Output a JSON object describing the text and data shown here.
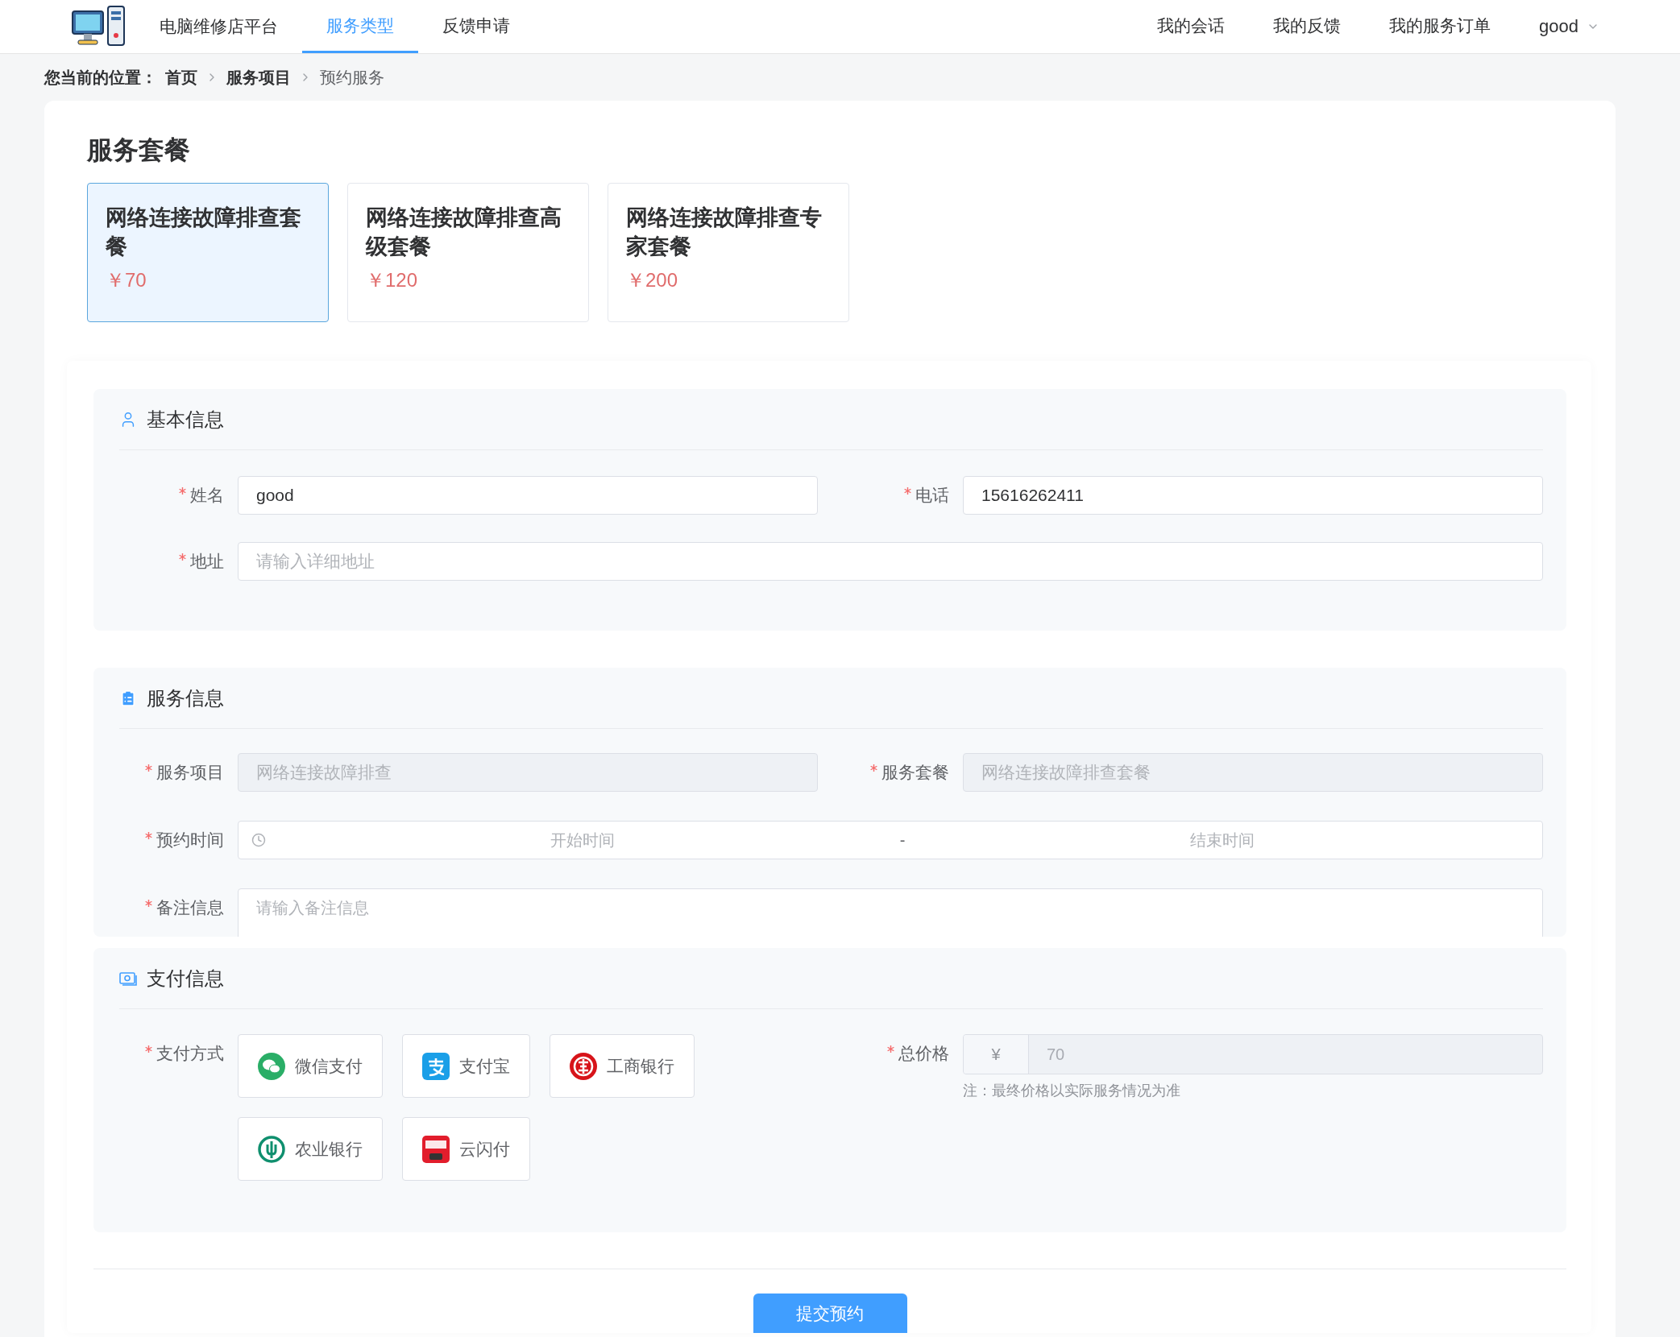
{
  "nav": {
    "brand": "电脑维修店平台",
    "tabs": [
      {
        "label": "服务类型",
        "selected": true
      },
      {
        "label": "反馈申请",
        "selected": false
      }
    ],
    "links": [
      "我的会话",
      "我的反馈",
      "我的服务订单"
    ],
    "user": "good"
  },
  "breadcrumb": {
    "prefix": "您当前的位置：",
    "items": [
      {
        "label": "首页",
        "current": false
      },
      {
        "label": "服务项目",
        "current": false
      },
      {
        "label": "预约服务",
        "current": true
      }
    ]
  },
  "packages": {
    "title": "服务套餐",
    "items": [
      {
        "name": "网络连接故障排查套餐",
        "price": "￥70",
        "selected": true
      },
      {
        "name": "网络连接故障排查高级套餐",
        "price": "￥120",
        "selected": false
      },
      {
        "name": "网络连接故障排查专家套餐",
        "price": "￥200",
        "selected": false
      }
    ]
  },
  "basic_info": {
    "title": "基本信息",
    "name": {
      "label": "姓名",
      "required": true,
      "value": "good"
    },
    "phone": {
      "label": "电话",
      "required": true,
      "value": "15616262411"
    },
    "address": {
      "label": "地址",
      "required": true,
      "placeholder": "请输入详细地址"
    }
  },
  "service_info": {
    "title": "服务信息",
    "project": {
      "label": "服务项目",
      "required": true,
      "placeholder": "网络连接故障排查",
      "disabled": true
    },
    "package": {
      "label": "服务套餐",
      "required": true,
      "placeholder": "网络连接故障排查套餐",
      "disabled": true
    },
    "time": {
      "label": "预约时间",
      "required": true,
      "start_placeholder": "开始时间",
      "separator": "-",
      "end_placeholder": "结束时间"
    },
    "remark": {
      "label": "备注信息",
      "required": true,
      "placeholder": "请输入备注信息"
    }
  },
  "payment_info": {
    "title": "支付信息",
    "method": {
      "label": "支付方式",
      "required": true,
      "options": [
        {
          "label": "微信支付",
          "kind": "wechat",
          "selected": false
        },
        {
          "label": "支付宝",
          "kind": "alipay",
          "selected": false
        },
        {
          "label": "工商银行",
          "kind": "icbc",
          "selected": false
        },
        {
          "label": "农业银行",
          "kind": "abc",
          "selected": false
        },
        {
          "label": "云闪付",
          "kind": "unionpay",
          "selected": false
        }
      ]
    },
    "total": {
      "label": "总价格",
      "required": true,
      "prefix": "¥",
      "value": "70",
      "disabled": true,
      "note": "注：最终价格以实际服务情况为准"
    }
  },
  "submit": "提交预约"
}
